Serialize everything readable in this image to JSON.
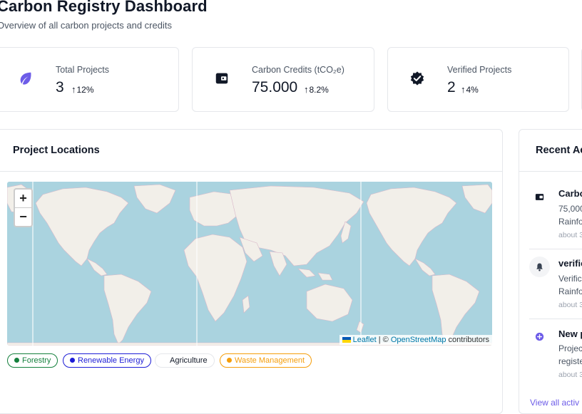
{
  "header": {
    "title": "Carbon Registry Dashboard",
    "subtitle": "Overview of all carbon projects and credits"
  },
  "stats": [
    {
      "label": "Total Projects",
      "value": "3",
      "change": "12%",
      "icon": "leaf-icon",
      "color": "#6d5ce8"
    },
    {
      "label": "Carbon Credits (tCO₂e)",
      "value": "75.000",
      "change": "8.2%",
      "icon": "wallet-icon",
      "color": "#111827"
    },
    {
      "label": "Verified Projects",
      "value": "2",
      "change": "4%",
      "icon": "verified-badge-icon",
      "color": "#111827"
    }
  ],
  "map_card": {
    "title": "Project Locations",
    "zoom_in": "+",
    "zoom_out": "−",
    "attribution": {
      "leaflet": "Leaflet",
      "separator": " | © ",
      "osm": "OpenStreetMap",
      "suffix": " contributors"
    },
    "legend": [
      {
        "label": "Forestry",
        "color": "#15803d"
      },
      {
        "label": "Renewable Energy",
        "color": "#1d1dd6"
      },
      {
        "label": "Agriculture",
        "color": "#111827"
      },
      {
        "label": "Waste Management",
        "color": "#f59e0b"
      }
    ]
  },
  "activity": {
    "title": "Recent Ac",
    "items": [
      {
        "icon": "wallet-icon",
        "title": "Carbo",
        "line1": "75,000",
        "line2": "Rainfo",
        "time": "about 3"
      },
      {
        "icon": "bell-icon",
        "title": "verific",
        "line1": "Verific",
        "line2": "Rainfo",
        "time": "about 3"
      },
      {
        "icon": "plus-circle-icon",
        "title": "New p",
        "line1": "Projec",
        "line2": "registe",
        "time": "about 3"
      }
    ],
    "view_all": "View all activ"
  },
  "colors": {
    "accent": "#6d5ce8",
    "border": "#e5e7eb",
    "water": "#aad3df",
    "land": "#f2efe9"
  }
}
